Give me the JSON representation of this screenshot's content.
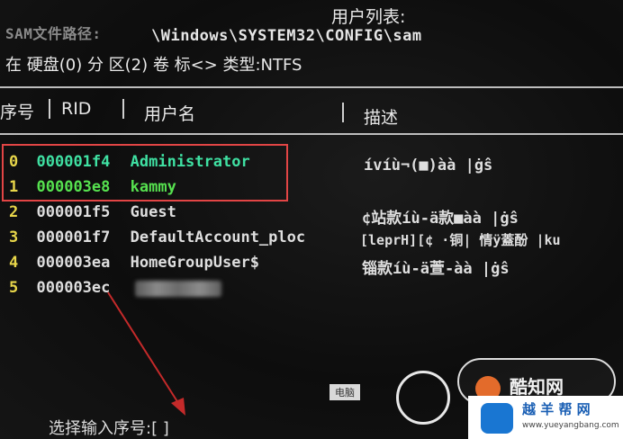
{
  "header": {
    "title": "用户列表:",
    "sam_label": "SAM文件路径:",
    "sam_path": "\\Windows\\SYSTEM32\\CONFIG\\sam",
    "disk_line": "在 硬盘(0)  分 区(2) 卷 标<> 类型:NTFS"
  },
  "table": {
    "columns": [
      "序号",
      "RID",
      "用户名",
      "描述"
    ],
    "rows": [
      {
        "idx": "0",
        "rid": "000001f4",
        "user": "Administrator",
        "desc": "ívíù¬(■)àà |ġŝ"
      },
      {
        "idx": "1",
        "rid": "000003e8",
        "user": "kammy",
        "desc": ""
      },
      {
        "idx": "2",
        "rid": "000001f5",
        "user": "Guest",
        "desc": "¢站款íù-ä款■àà |ġŝ"
      },
      {
        "idx": "3",
        "rid": "000001f7",
        "user": "DefaultAccount_ploc",
        "desc": "[leprH][¢ ·铜| 情ÿ蓋酚 |ku"
      },
      {
        "idx": "4",
        "rid": "000003ea",
        "user": "HomeGroupUser$",
        "desc": "锱款íù-ä萱-àà |ġŝ"
      },
      {
        "idx": "5",
        "rid": "000003ec",
        "user": "",
        "desc": ""
      }
    ]
  },
  "prompt": "选择输入序号:[ ]",
  "overlay": {
    "image_tag": "电脑",
    "brand": "酷知网",
    "site_name": "越 羊 帮 网",
    "site_url": "www.yueyangbang.com"
  },
  "colors": {
    "highlight_box": "#e24545",
    "admin_text": "#3fe0a2",
    "kammy_text": "#56e14f",
    "index_yellow": "#e8d64a"
  }
}
